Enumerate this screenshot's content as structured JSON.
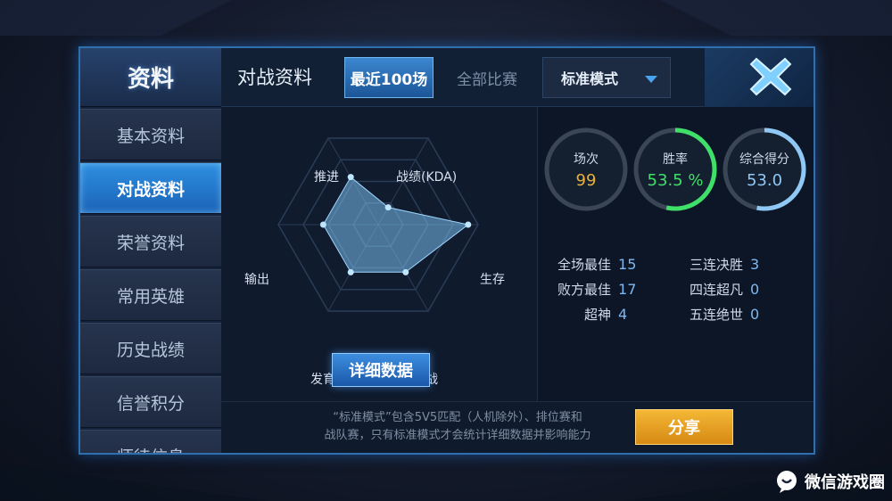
{
  "sidebar": {
    "title": "资料",
    "items": [
      {
        "label": "基本资料",
        "active": false
      },
      {
        "label": "对战资料",
        "active": true
      },
      {
        "label": "荣誉资料",
        "active": false
      },
      {
        "label": "常用英雄",
        "active": false
      },
      {
        "label": "历史战绩",
        "active": false
      },
      {
        "label": "信誉积分",
        "active": false
      },
      {
        "label": "师徒信息",
        "active": false
      }
    ]
  },
  "header": {
    "title": "对战资料",
    "tabs": [
      {
        "label": "最近100场",
        "active": true
      },
      {
        "label": "全部比赛",
        "active": false
      }
    ],
    "mode_select": {
      "value": "标准模式"
    },
    "close_icon": "close-x-icon"
  },
  "radar": {
    "axes": [
      "推进",
      "战绩(KDA)",
      "生存",
      "团战",
      "发育",
      "输出"
    ],
    "values": [
      0.55,
      0.2,
      0.9,
      0.55,
      0.55,
      0.55
    ],
    "detail_button": "详细数据"
  },
  "stats": {
    "gauges": [
      {
        "label": "场次",
        "value": "99",
        "color": "#e8b23a",
        "fill": 0
      },
      {
        "label": "胜率",
        "value": "53.5 %",
        "color": "#3fe06a",
        "fill": 0.535
      },
      {
        "label": "综合得分",
        "value": "53.0",
        "color": "#8fc8f5",
        "fill": 0.53
      }
    ],
    "left": [
      {
        "label": "全场最佳",
        "value": "15"
      },
      {
        "label": "败方最佳",
        "value": "17"
      },
      {
        "label": "超神",
        "value": "4"
      }
    ],
    "right": [
      {
        "label": "三连决胜",
        "value": "3"
      },
      {
        "label": "四连超凡",
        "value": "0"
      },
      {
        "label": "五连绝世",
        "value": "0"
      }
    ]
  },
  "footer": {
    "note_line1": "“标准模式”包含5V5匹配（人机除外）、排位赛和",
    "note_line2": "战队赛，只有标准模式才会统计详细数据并影响能力",
    "share_button": "分享"
  },
  "watermark": {
    "text": "微信游戏圈"
  },
  "colors": {
    "accent": "#2f8fe0",
    "share": "#f0a428",
    "win": "#3fe06a",
    "games": "#e8b23a",
    "score": "#8fc8f5"
  }
}
